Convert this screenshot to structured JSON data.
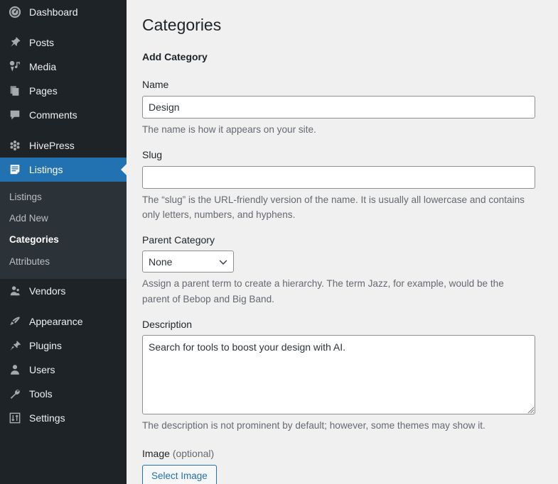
{
  "colors": {
    "sidebar_bg": "#1d2327",
    "submenu_bg": "#2c3338",
    "accent_blue": "#2271b1",
    "content_bg": "#f0f0f1",
    "input_border": "#8c8f94",
    "muted_text": "#646970"
  },
  "sidebar": {
    "items": [
      {
        "label": "Dashboard",
        "icon": "dashboard-icon",
        "active": false,
        "gap_after": true
      },
      {
        "label": "Posts",
        "icon": "pin-icon",
        "active": false,
        "gap_after": false
      },
      {
        "label": "Media",
        "icon": "media-icon",
        "active": false,
        "gap_after": false
      },
      {
        "label": "Pages",
        "icon": "pages-icon",
        "active": false,
        "gap_after": false
      },
      {
        "label": "Comments",
        "icon": "comment-icon",
        "active": false,
        "gap_after": true
      },
      {
        "label": "HivePress",
        "icon": "hivepress-icon",
        "active": false,
        "gap_after": false
      },
      {
        "label": "Listings",
        "icon": "listings-icon",
        "active": true,
        "gap_after": false
      }
    ],
    "submenu": [
      {
        "label": "Listings",
        "current": false
      },
      {
        "label": "Add New",
        "current": false
      },
      {
        "label": "Categories",
        "current": true
      },
      {
        "label": "Attributes",
        "current": false
      }
    ],
    "items_after": [
      {
        "label": "Vendors",
        "icon": "vendor-icon",
        "active": false,
        "gap_after": true
      },
      {
        "label": "Appearance",
        "icon": "brush-icon",
        "active": false,
        "gap_after": false
      },
      {
        "label": "Plugins",
        "icon": "plug-icon",
        "active": false,
        "gap_after": false
      },
      {
        "label": "Users",
        "icon": "user-icon",
        "active": false,
        "gap_after": false
      },
      {
        "label": "Tools",
        "icon": "wrench-icon",
        "active": false,
        "gap_after": false
      },
      {
        "label": "Settings",
        "icon": "sliders-icon",
        "active": false,
        "gap_after": false
      }
    ]
  },
  "main": {
    "page_title": "Categories",
    "form_title": "Add Category",
    "fields": {
      "name": {
        "label": "Name",
        "value": "Design",
        "placeholder": "",
        "description": "The name is how it appears on your site."
      },
      "slug": {
        "label": "Slug",
        "value": "",
        "placeholder": "",
        "description": "The “slug” is the URL-friendly version of the name. It is usually all lowercase and contains only letters, numbers, and hyphens."
      },
      "parent_category": {
        "label": "Parent Category",
        "value": "None",
        "options": [
          "None"
        ],
        "description": "Assign a parent term to create a hierarchy. The term Jazz, for example, would be the parent of Bebop and Big Band."
      },
      "description": {
        "label": "Description",
        "value": "Search for tools to boost your design with AI.",
        "placeholder": "",
        "description": "The description is not prominent by default; however, some themes may show it."
      },
      "image": {
        "label": "Image",
        "optional_suffix": "(optional)",
        "button_label": "Select Image"
      }
    }
  }
}
